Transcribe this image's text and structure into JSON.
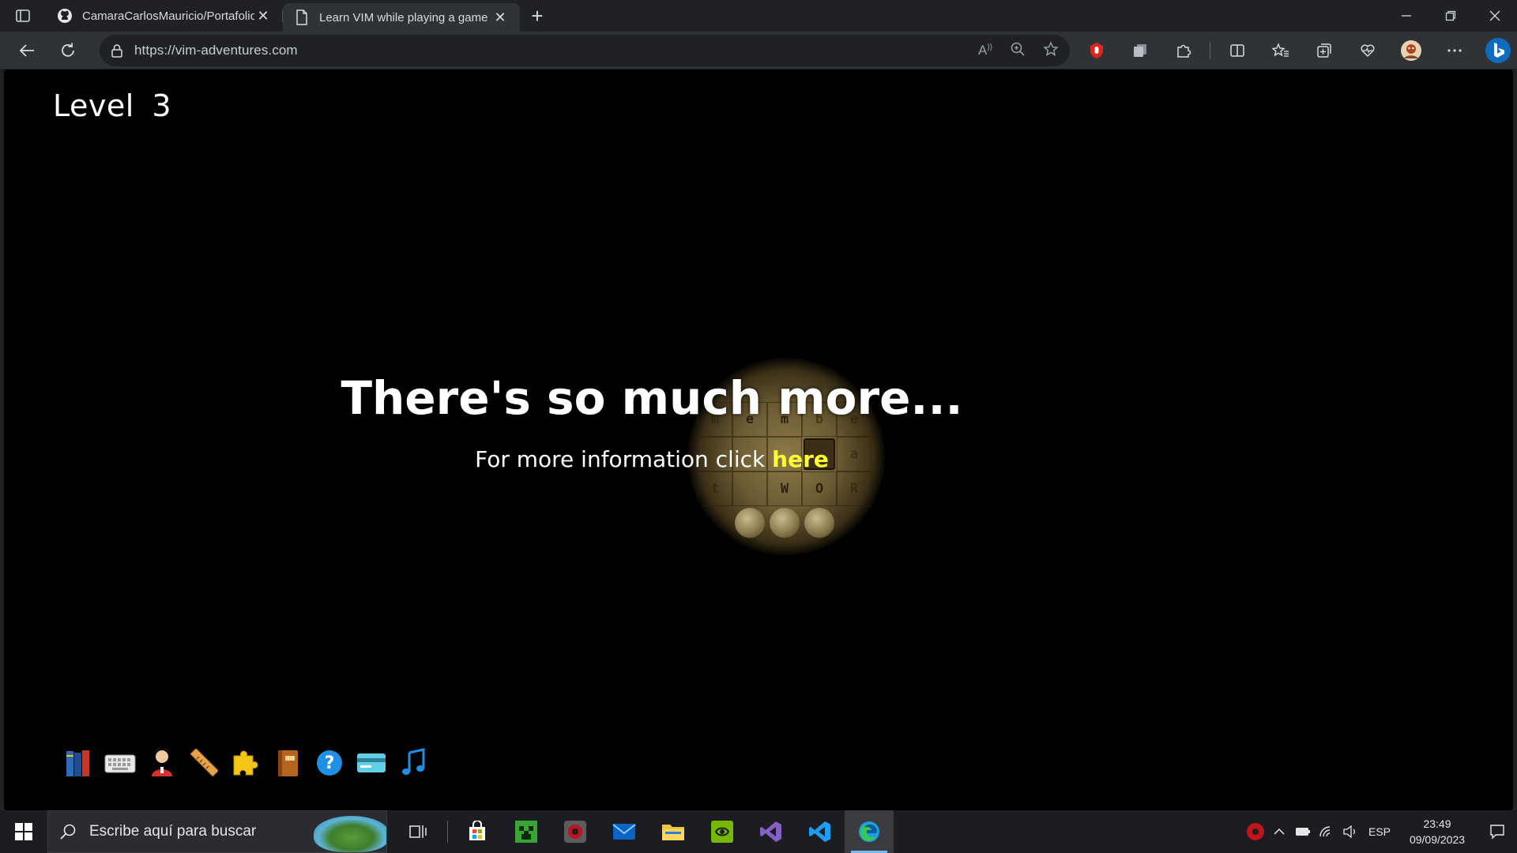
{
  "browser": {
    "tabs": [
      {
        "title": "CamaraCarlosMauricio/Portafolio",
        "favicon": "github-icon",
        "active": false
      },
      {
        "title": "Learn VIM while playing a game",
        "favicon": "page-icon",
        "active": true
      }
    ],
    "address": {
      "url": "https://vim-adventures.com"
    }
  },
  "game": {
    "level_label": "Level",
    "level_number": "3",
    "headline": "There's so much more...",
    "info_prefix": "For more information click",
    "info_link": "here",
    "grid_letters": [
      "m",
      "e",
      "m",
      "b",
      "e",
      "a",
      "t",
      "W",
      "O",
      "R"
    ],
    "toolbar_icons": [
      "books-icon",
      "keyboard-icon",
      "user-icon",
      "ruler-icon",
      "puzzle-icon",
      "book-icon",
      "help-icon",
      "card-icon",
      "music-icon"
    ]
  },
  "taskbar": {
    "search_placeholder": "Escribe aquí para buscar",
    "language": "ESP",
    "time": "23:49",
    "date": "09/09/2023"
  }
}
